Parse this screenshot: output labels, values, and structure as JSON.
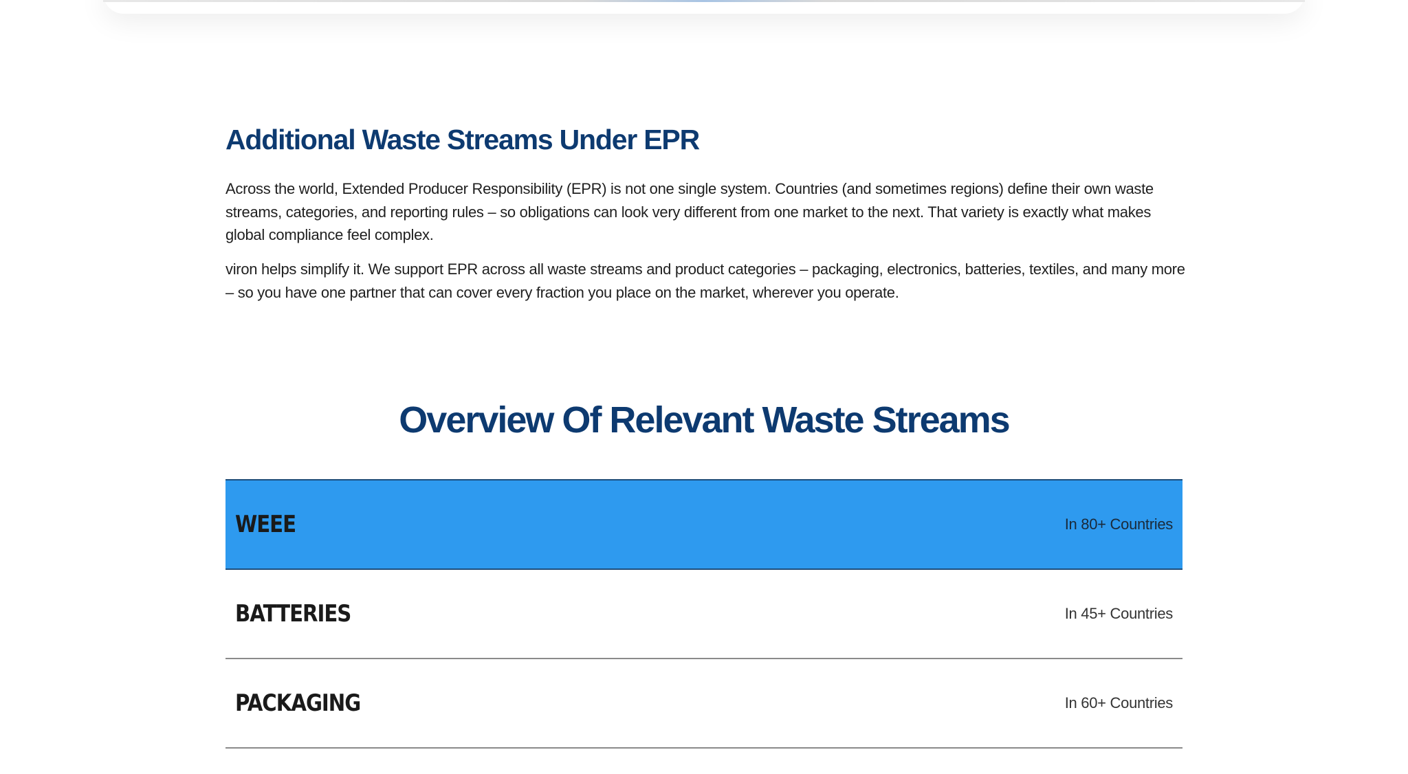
{
  "intro": {
    "title": "Additional Waste Streams Under EPR",
    "paragraphs": [
      "Across the world, Extended Producer Responsibility (EPR) is not one single system. Countries (and sometimes regions) define their own waste streams, categories, and reporting rules – so obligations can look very different from one market to the next. That variety is exactly what makes global compliance feel complex.",
      "viron helps simplify it. We support EPR across all waste streams and product categories – packaging, electronics, batteries, textiles, and many more – so you have one partner that can cover every fraction you place on the market, wherever you operate."
    ]
  },
  "overview": {
    "title": "Overview Of Relevant Waste Streams",
    "streams": [
      {
        "name": "WEEE",
        "countries": "In 80+ Countries",
        "active": true
      },
      {
        "name": "BATTERIES",
        "countries": "In 45+ Countries",
        "active": false
      },
      {
        "name": "PACKAGING",
        "countries": "In 60+ Countries",
        "active": false
      }
    ]
  },
  "colors": {
    "heading": "#0d3a70",
    "active_row": "#2e9aef",
    "body_text": "#1f1f1f",
    "divider": "#8a8a8a"
  }
}
